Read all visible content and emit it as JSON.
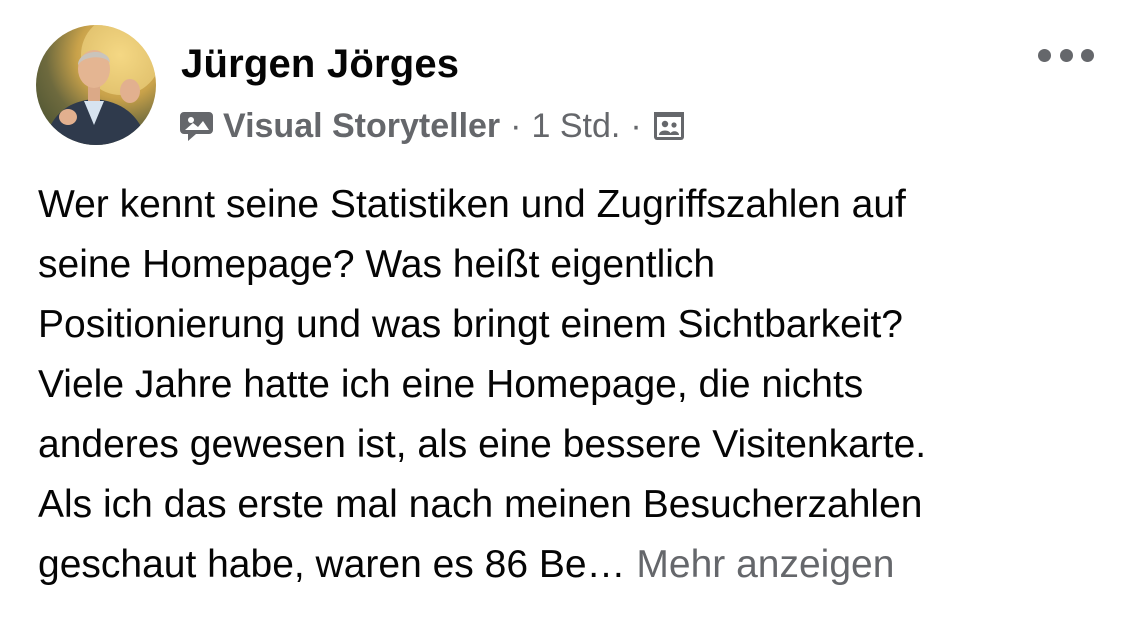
{
  "post": {
    "author": "Jürgen Jörges",
    "badge": "Visual Storyteller",
    "separator": "·",
    "time": "1 Std.",
    "audience_icon": "friends-audience-icon",
    "badge_icon": "visual-storyteller-icon",
    "more_icon": "more-options-icon",
    "text_lines": [
      "Wer kennt seine Statistiken und Zugriffszahlen auf",
      "seine Homepage? Was heißt eigentlich",
      "Positionierung und was bringt einem Sichtbarkeit?",
      "Viele Jahre hatte ich eine Homepage, die nichts",
      "anderes gewesen ist, als eine bessere Visitenkarte.",
      "Als ich das erste mal nach meinen Besucherzahlen",
      "geschaut habe, waren es 86 Be…"
    ],
    "see_more": "Mehr anzeigen"
  },
  "colors": {
    "primary_text": "#050505",
    "secondary_text": "#65676b",
    "background": "#ffffff"
  }
}
